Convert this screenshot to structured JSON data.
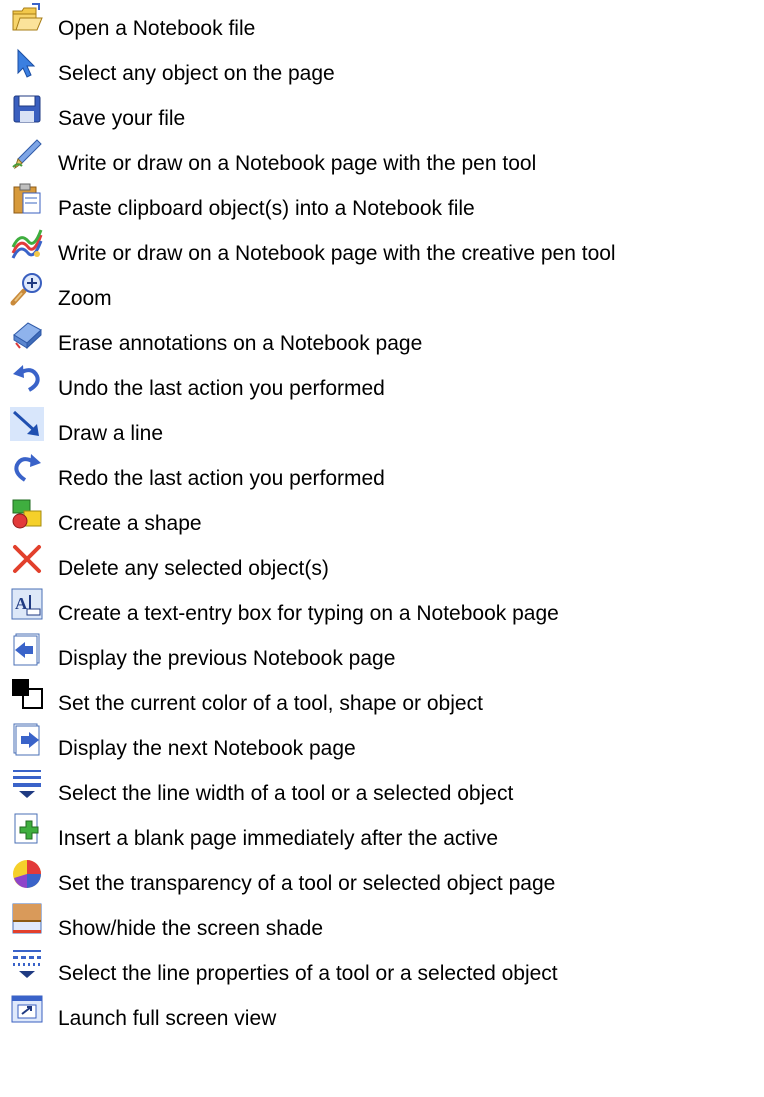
{
  "items": [
    {
      "icon": "open-folder-icon",
      "label": "Open a Notebook file"
    },
    {
      "icon": "select-arrow-icon",
      "label": "Select any object on the page"
    },
    {
      "icon": "save-disk-icon",
      "label": "Save your file"
    },
    {
      "icon": "pen-icon",
      "label": "Write or draw on a Notebook page with the pen tool"
    },
    {
      "icon": "paste-clipboard-icon",
      "label": "Paste clipboard object(s) into a Notebook file"
    },
    {
      "icon": "creative-pen-icon",
      "label": "Write or draw on a Notebook page with the creative pen tool"
    },
    {
      "icon": "zoom-icon",
      "label": "Zoom"
    },
    {
      "icon": "eraser-icon",
      "label": "Erase annotations on a Notebook page"
    },
    {
      "icon": "undo-icon",
      "label": "Undo the last action you performed"
    },
    {
      "icon": "line-icon",
      "label": "Draw a line"
    },
    {
      "icon": "redo-icon",
      "label": "Redo the last action you performed"
    },
    {
      "icon": "shapes-icon",
      "label": "Create a shape"
    },
    {
      "icon": "delete-icon",
      "label": "Delete any selected object(s)"
    },
    {
      "icon": "text-box-icon",
      "label": "Create a text-entry box for typing on a Notebook page"
    },
    {
      "icon": "previous-page-icon",
      "label": "Display the previous Notebook page"
    },
    {
      "icon": "color-icon",
      "label": "Set the current color of a tool, shape or object"
    },
    {
      "icon": "next-page-icon",
      "label": "Display the next Notebook page"
    },
    {
      "icon": "line-width-icon",
      "label": "Select the line width of a tool or a selected object"
    },
    {
      "icon": "insert-page-icon",
      "label": "Insert a blank page immediately after the active"
    },
    {
      "icon": "transparency-icon",
      "label": "Set the transparency of a tool or selected object page"
    },
    {
      "icon": "screen-shade-icon",
      "label": "Show/hide the screen shade"
    },
    {
      "icon": "line-properties-icon",
      "label": "Select the line properties of a tool or a selected object"
    },
    {
      "icon": "full-screen-icon",
      "label": "Launch full screen view"
    }
  ]
}
